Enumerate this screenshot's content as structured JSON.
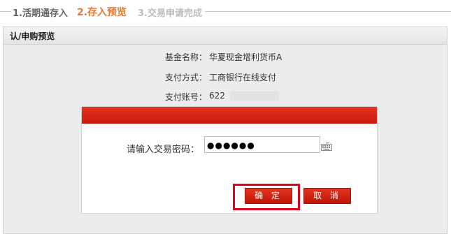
{
  "steps": {
    "step1": "1.活期通存入",
    "step2": "2.存入预览",
    "step3": "3.交易申请完成"
  },
  "panel": {
    "title": "认/申购预览"
  },
  "info": {
    "fund_name_label": "基金名称：",
    "fund_name_value": "华夏现金增利货币A",
    "payment_label": "支付方式：",
    "payment_value": "工商银行在线支付",
    "account_label": "支付账号：",
    "account_value": "622"
  },
  "dialog": {
    "password_label": "请输入交易密码：",
    "password_value": "●●●●●●",
    "confirm_label": "确 定",
    "cancel_label": "取 消"
  },
  "icons": {
    "keyboard": "keyboard-icon"
  },
  "colors": {
    "accent_orange": "#e9772c",
    "dialog_red": "#d42414",
    "highlight_red": "#e4001d"
  }
}
